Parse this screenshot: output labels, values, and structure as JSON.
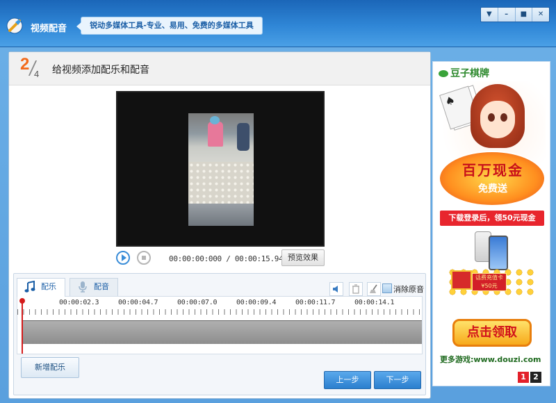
{
  "app": {
    "title": "视频配音",
    "slogan": "锐动多媒体工具-专业、易用、免费的多媒体工具"
  },
  "window_controls": [
    {
      "name": "menu-dropdown",
      "icon": "chevron-down-icon",
      "glyph": "▼"
    },
    {
      "name": "minimize",
      "icon": "minimize-icon",
      "glyph": "–"
    },
    {
      "name": "maximize",
      "icon": "maximize-icon",
      "glyph": "■"
    },
    {
      "name": "close",
      "icon": "close-icon",
      "glyph": "✕"
    }
  ],
  "step": {
    "current": "2",
    "total": "4",
    "title": "给视频添加配乐和配音"
  },
  "player": {
    "time_current": "00:00:00:000",
    "time_total": "00:00:15.949",
    "time_separator": "/",
    "preview_label": "预览效果"
  },
  "tabs": [
    {
      "label": "配乐",
      "icon": "music-note-icon",
      "active": true
    },
    {
      "label": "配音",
      "icon": "microphone-icon",
      "active": false
    }
  ],
  "tools": {
    "mute_label": "消除原音"
  },
  "timeline": {
    "ticks": [
      "00:00:02.3",
      "00:00:04.7",
      "00:00:07.0",
      "00:00:09.4",
      "00:00:11.7",
      "00:00:14.1"
    ],
    "playhead_position_sec": 0
  },
  "buttons": {
    "add_music": "新增配乐",
    "prev": "上一步",
    "next": "下一步"
  },
  "ad": {
    "brand": "豆子棋牌",
    "promo_main": "百万现金",
    "promo_sub": "免费送",
    "strip": "下载登录后，领50元现金",
    "coupon": "话费充值卡 ¥50元",
    "claim": "点击领取",
    "url": "更多游戏:www.douzi.com",
    "pages": [
      "1",
      "2"
    ]
  },
  "colors": {
    "accent_blue": "#2b7fce",
    "step_orange": "#f26a1b",
    "playhead_red": "#d41b1b"
  }
}
